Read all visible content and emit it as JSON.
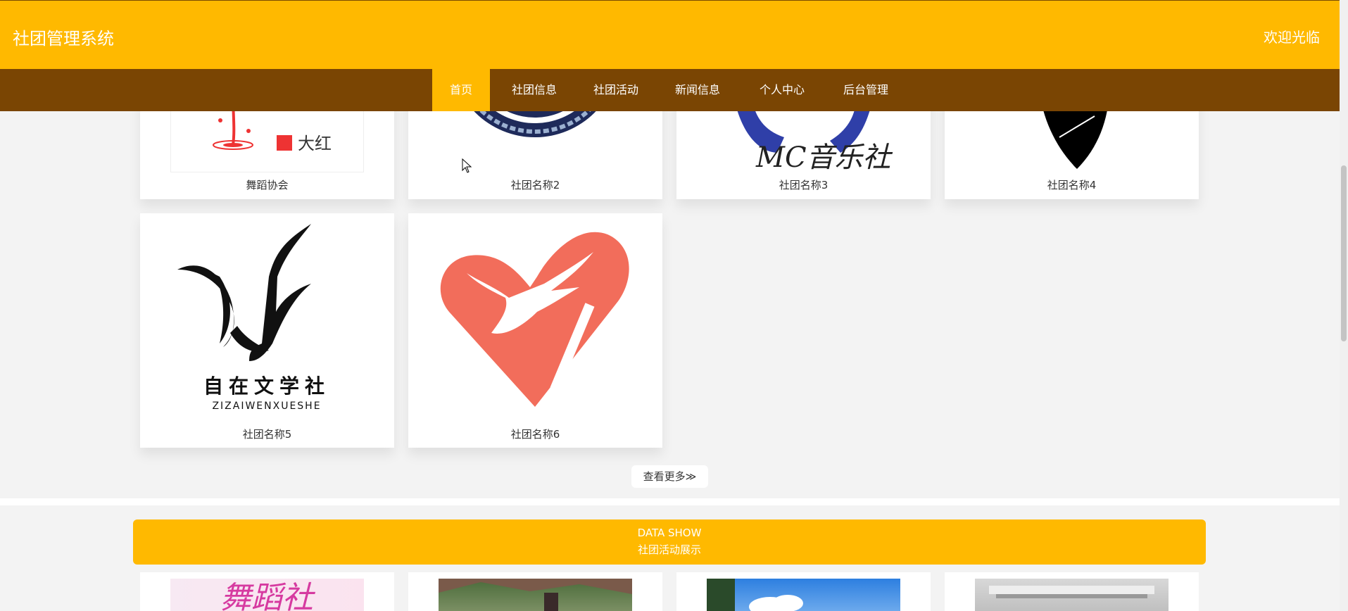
{
  "header": {
    "title": "社团管理系统",
    "welcome": "欢迎光临"
  },
  "nav": {
    "items": [
      {
        "label": "首页",
        "active": true
      },
      {
        "label": "社团信息"
      },
      {
        "label": "社团活动"
      },
      {
        "label": "新闻信息"
      },
      {
        "label": "个人中心"
      },
      {
        "label": "后台管理"
      }
    ]
  },
  "clubs": {
    "items": [
      {
        "name": "舞蹈协会",
        "logo_text": "大红"
      },
      {
        "name": "社团名称2"
      },
      {
        "name": "社团名称3",
        "logo_text": "MC音乐社"
      },
      {
        "name": "社团名称4"
      },
      {
        "name": "社团名称5",
        "logo_text": "自在文学社",
        "logo_subtext": "ZIZAIWENXUESHE"
      },
      {
        "name": "社团名称6"
      }
    ],
    "more_label": "查看更多≫"
  },
  "data_show": {
    "title": "DATA SHOW",
    "subtitle": "社团活动展示",
    "first_image_text": "舞蹈社"
  },
  "colors": {
    "primary": "#ffb900",
    "nav": "#7a4503",
    "background": "#f3f3f3",
    "heart": "#f26d5b"
  }
}
